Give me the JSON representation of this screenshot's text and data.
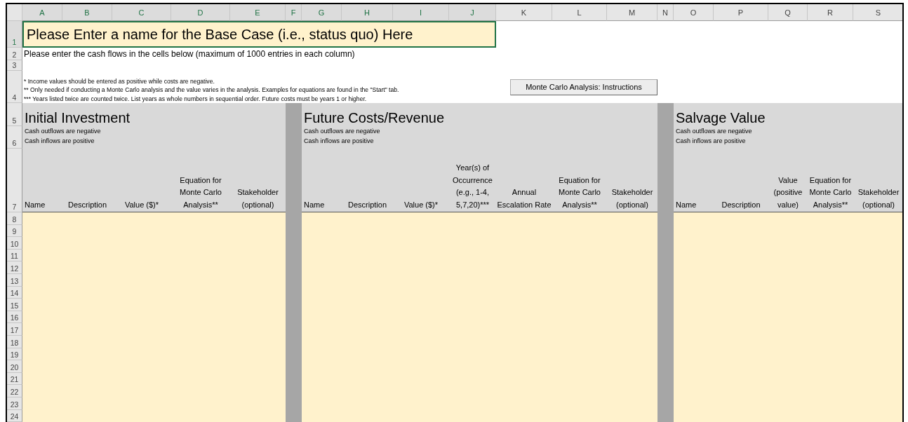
{
  "column_headers": [
    {
      "label": "A",
      "selected": true
    },
    {
      "label": "B",
      "selected": true
    },
    {
      "label": "C",
      "selected": true
    },
    {
      "label": "D",
      "selected": true
    },
    {
      "label": "E",
      "selected": true
    },
    {
      "label": "F",
      "selected": true
    },
    {
      "label": "G",
      "selected": true
    },
    {
      "label": "H",
      "selected": true
    },
    {
      "label": "I",
      "selected": true
    },
    {
      "label": "J",
      "selected": true
    },
    {
      "label": "K",
      "selected": false
    },
    {
      "label": "L",
      "selected": false
    },
    {
      "label": "M",
      "selected": false
    },
    {
      "label": "N",
      "selected": false
    },
    {
      "label": "O",
      "selected": false
    },
    {
      "label": "P",
      "selected": false
    },
    {
      "label": "Q",
      "selected": false
    },
    {
      "label": "R",
      "selected": false
    },
    {
      "label": "S",
      "selected": false
    }
  ],
  "row_headers": [
    {
      "label": "1",
      "selected": true
    },
    {
      "label": "2",
      "selected": false
    },
    {
      "label": "3",
      "selected": false
    },
    {
      "label": "4",
      "selected": false
    },
    {
      "label": "5",
      "selected": false
    },
    {
      "label": "6",
      "selected": false
    },
    {
      "label": "7",
      "selected": false
    },
    {
      "label": "8",
      "selected": false
    },
    {
      "label": "9",
      "selected": false
    },
    {
      "label": "10",
      "selected": false
    },
    {
      "label": "11",
      "selected": false
    },
    {
      "label": "12",
      "selected": false
    },
    {
      "label": "13",
      "selected": false
    },
    {
      "label": "14",
      "selected": false
    },
    {
      "label": "15",
      "selected": false
    },
    {
      "label": "16",
      "selected": false
    },
    {
      "label": "17",
      "selected": false
    },
    {
      "label": "18",
      "selected": false
    },
    {
      "label": "19",
      "selected": false
    },
    {
      "label": "20",
      "selected": false
    },
    {
      "label": "21",
      "selected": false
    },
    {
      "label": "22",
      "selected": false
    },
    {
      "label": "23",
      "selected": false
    },
    {
      "label": "24",
      "selected": false
    }
  ],
  "title_cell": {
    "value": "Please Enter a name for the Base Case (i.e., status quo) Here",
    "selected": true
  },
  "instruction": "Please enter the cash flows in the cells below (maximum of 1000 entries in each column)",
  "notes": [
    "* Income values should be entered as positive while costs are negative.",
    "** Only needed if conducting a Monte Carlo analysis and the value varies in the analysis. Examples for equations are found in the \"Start\" tab.",
    "*** Years listed twice are counted twice. List years as whole numbers in sequential order. Future costs must be years 1 or higher."
  ],
  "button": "Monte Carlo Analysis: Instructions",
  "sections": [
    {
      "title": "Initial Investment",
      "notes": [
        "Cash outflows are negative",
        "Cash inflows are positive"
      ],
      "headings": [
        "Name",
        "Description",
        "Value ($)*",
        "Equation for Monte Carlo Analysis**",
        "Stakeholder (optional)"
      ]
    },
    {
      "title": "Future Costs/Revenue",
      "notes": [
        "Cash outflows are negative",
        "Cash inflows are positive"
      ],
      "headings": [
        "Name",
        "Description",
        "Value ($)*",
        "Year(s) of Occurrence (e.g., 1-4, 5,7,20)***",
        "Annual Escalation Rate",
        "Equation for Monte Carlo Analysis**",
        "Stakeholder (optional)"
      ]
    },
    {
      "title": "Salvage Value",
      "notes": [
        "Cash outflows are negative",
        "Cash inflows are positive"
      ],
      "headings": [
        "Name",
        "Description",
        "Value (positive value)",
        "Equation for Monte Carlo Analysis**",
        "Stakeholder (optional)"
      ]
    }
  ]
}
